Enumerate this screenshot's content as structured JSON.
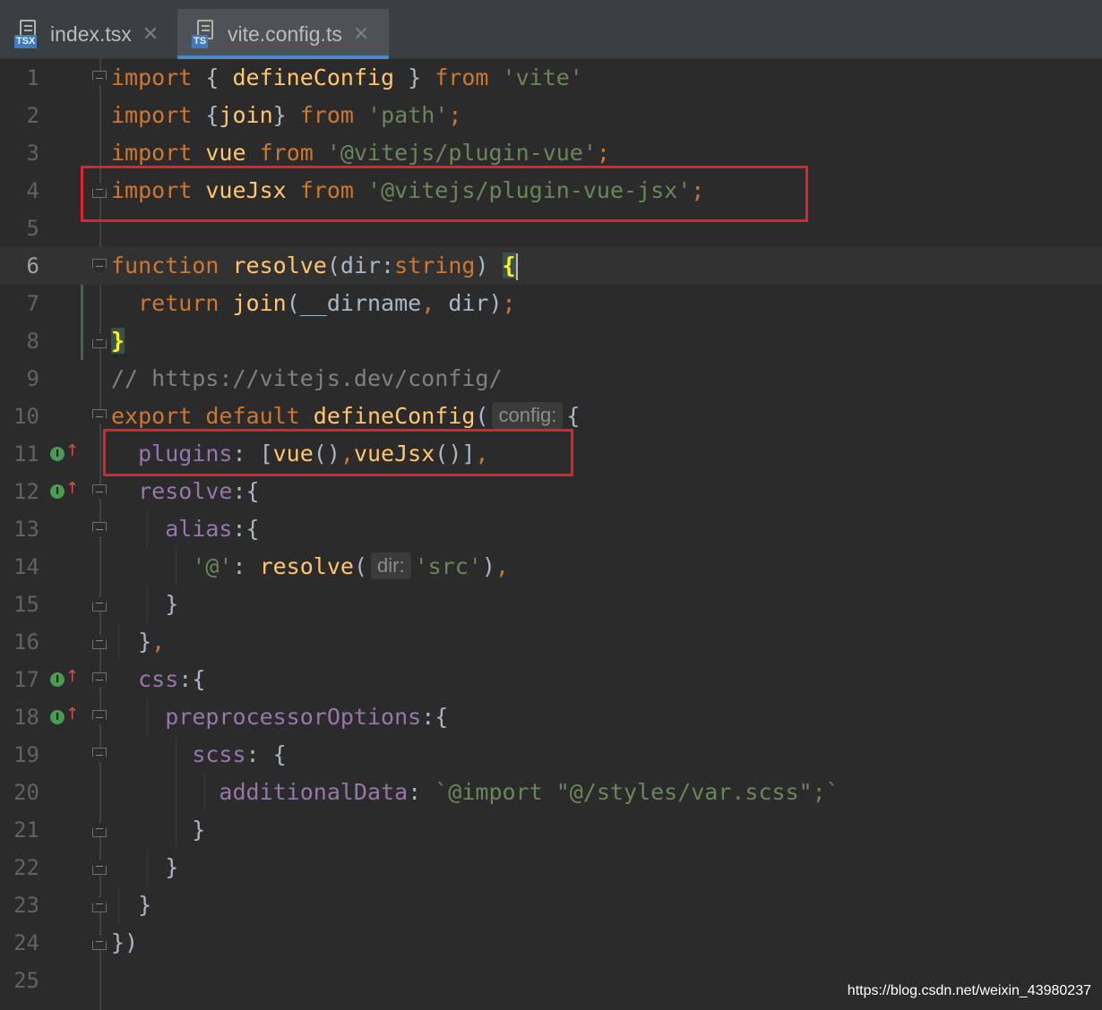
{
  "tabs": [
    {
      "label": "index.tsx",
      "badge": "TSX",
      "active": false
    },
    {
      "label": "vite.config.ts",
      "badge": "TS",
      "active": true
    }
  ],
  "close_glyph": "✕",
  "colors": {
    "background": "#2b2b2b",
    "keyword": "#cc7832",
    "function": "#ffc66d",
    "string": "#6a8759",
    "property": "#9876aa",
    "comment": "#808080",
    "default_text": "#a9b7c6",
    "highlight_box": "#e0232b"
  },
  "editor": {
    "current_line": 6,
    "line_numbers": [
      "1",
      "2",
      "3",
      "4",
      "5",
      "6",
      "7",
      "8",
      "9",
      "10",
      "11",
      "12",
      "13",
      "14",
      "15",
      "16",
      "17",
      "18",
      "19",
      "20",
      "21",
      "22",
      "23",
      "24",
      "25"
    ],
    "lines": [
      [
        {
          "t": "import",
          "c": "kw"
        },
        {
          "t": " { "
        },
        {
          "t": "defineConfig",
          "c": "fn"
        },
        {
          "t": " } "
        },
        {
          "t": "from",
          "c": "kw"
        },
        {
          "t": " "
        },
        {
          "t": "'vite'",
          "c": "str"
        }
      ],
      [
        {
          "t": "import",
          "c": "kw"
        },
        {
          "t": " {"
        },
        {
          "t": "join",
          "c": "fn"
        },
        {
          "t": "} "
        },
        {
          "t": "from",
          "c": "kw"
        },
        {
          "t": " "
        },
        {
          "t": "'path'",
          "c": "str"
        },
        {
          "t": ";",
          "c": "kw"
        }
      ],
      [
        {
          "t": "import",
          "c": "kw"
        },
        {
          "t": " "
        },
        {
          "t": "vue",
          "c": "fn"
        },
        {
          "t": " "
        },
        {
          "t": "from",
          "c": "kw"
        },
        {
          "t": " "
        },
        {
          "t": "'@vitejs/plugin-vue'",
          "c": "str"
        },
        {
          "t": ";",
          "c": "kw"
        }
      ],
      [
        {
          "t": "import",
          "c": "kw"
        },
        {
          "t": " "
        },
        {
          "t": "vueJsx",
          "c": "fn"
        },
        {
          "t": " "
        },
        {
          "t": "from",
          "c": "kw"
        },
        {
          "t": " "
        },
        {
          "t": "'@vitejs/plugin-vue-jsx'",
          "c": "str"
        },
        {
          "t": ";",
          "c": "kw"
        }
      ],
      [],
      [
        {
          "t": "function",
          "c": "kw"
        },
        {
          "t": " "
        },
        {
          "t": "resolve",
          "c": "fn"
        },
        {
          "t": "(dir:"
        },
        {
          "t": "string",
          "c": "kw"
        },
        {
          "t": ") "
        },
        {
          "t": "{",
          "c": "brace-hl"
        },
        {
          "caret": true
        }
      ],
      [
        {
          "t": "  "
        },
        {
          "t": "return",
          "c": "kw"
        },
        {
          "t": " "
        },
        {
          "t": "join",
          "c": "fn"
        },
        {
          "t": "(__dirname"
        },
        {
          "t": ",",
          "c": "kw"
        },
        {
          "t": " dir)"
        },
        {
          "t": ";",
          "c": "kw"
        }
      ],
      [
        {
          "t": "}",
          "c": "brace-hl"
        }
      ],
      [
        {
          "t": "// ",
          "c": "cm"
        },
        {
          "t": "https://vitejs.dev/config/",
          "c": "cm link"
        }
      ],
      [
        {
          "t": "export",
          "c": "kw"
        },
        {
          "t": " "
        },
        {
          "t": "default",
          "c": "kw"
        },
        {
          "t": " "
        },
        {
          "t": "defineConfig",
          "c": "fn"
        },
        {
          "t": "("
        },
        {
          "hint": "config:"
        },
        {
          "t": "{"
        }
      ],
      [
        {
          "t": "  "
        },
        {
          "t": "plugins",
          "c": "prop"
        },
        {
          "t": ": ["
        },
        {
          "t": "vue",
          "c": "fn"
        },
        {
          "t": "()"
        },
        {
          "t": ",",
          "c": "kw"
        },
        {
          "t": "vueJsx",
          "c": "fn"
        },
        {
          "t": "()]"
        },
        {
          "t": ",",
          "c": "kw"
        }
      ],
      [
        {
          "t": "  "
        },
        {
          "t": "resolve",
          "c": "prop"
        },
        {
          "t": ":{"
        }
      ],
      [
        {
          "t": "    "
        },
        {
          "t": "alias",
          "c": "prop"
        },
        {
          "t": ":{"
        }
      ],
      [
        {
          "t": "      "
        },
        {
          "t": "'@'",
          "c": "str"
        },
        {
          "t": ": "
        },
        {
          "t": "resolve",
          "c": "fn"
        },
        {
          "t": "("
        },
        {
          "hint": "dir:"
        },
        {
          "t": "'src'",
          "c": "str"
        },
        {
          "t": ")"
        },
        {
          "t": ",",
          "c": "kw"
        }
      ],
      [
        {
          "t": "    }"
        }
      ],
      [
        {
          "t": "  }"
        },
        {
          "t": ",",
          "c": "kw"
        }
      ],
      [
        {
          "t": "  "
        },
        {
          "t": "css",
          "c": "prop"
        },
        {
          "t": ":{"
        }
      ],
      [
        {
          "t": "    "
        },
        {
          "t": "preprocessorOptions",
          "c": "prop"
        },
        {
          "t": ":{"
        }
      ],
      [
        {
          "t": "      "
        },
        {
          "t": "scss",
          "c": "prop"
        },
        {
          "t": ": {"
        }
      ],
      [
        {
          "t": "        "
        },
        {
          "t": "additionalData",
          "c": "prop"
        },
        {
          "t": ": "
        },
        {
          "t": "`@import \"@/styles/var.scss\";`",
          "c": "str"
        }
      ],
      [
        {
          "t": "      }"
        }
      ],
      [
        {
          "t": "    }"
        }
      ],
      [
        {
          "t": "  }"
        }
      ],
      [
        {
          "t": "})"
        }
      ],
      []
    ],
    "implements_marker": "I"
  },
  "watermark": "https://blog.csdn.net/weixin_43980237"
}
